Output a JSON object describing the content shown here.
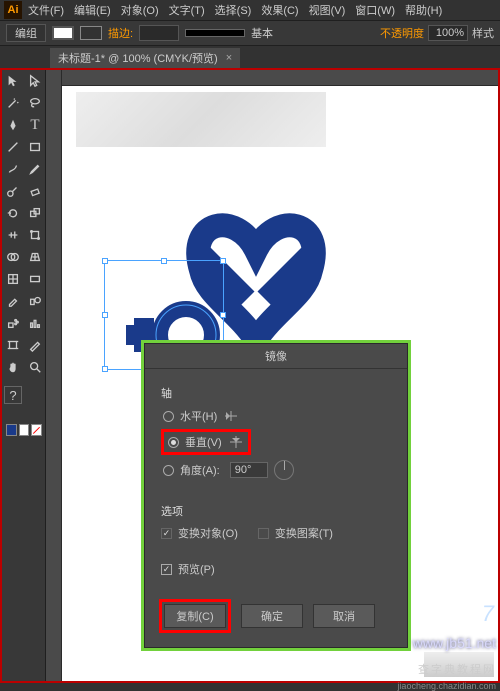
{
  "menu": {
    "file": "文件(F)",
    "edit": "编辑(E)",
    "object": "对象(O)",
    "type": "文字(T)",
    "select": "选择(S)",
    "effect": "效果(C)",
    "view": "视图(V)",
    "window": "窗口(W)",
    "help": "帮助(H)"
  },
  "optbar": {
    "group": "编组",
    "desc_label": "描边:",
    "basic": "基本",
    "opacity_label": "不透明度",
    "opacity_value": "100%",
    "style": "样式"
  },
  "doc_tab": "未标题-1* @ 100% (CMYK/预览)",
  "tools": {
    "selection": "selection",
    "direct": "direct-select",
    "wand": "magic-wand",
    "lasso": "lasso",
    "pen": "pen",
    "type": "type",
    "line": "line",
    "rect": "rectangle",
    "brush": "brush",
    "pencil": "pencil",
    "blob": "blob-brush",
    "eraser": "eraser",
    "rotate": "rotate",
    "scale": "scale",
    "width": "width",
    "warp": "free-transform",
    "shapebuilder": "shape-builder",
    "perspective": "perspective",
    "mesh": "mesh",
    "gradient": "gradient",
    "eyedrop": "eyedropper",
    "blend": "blend",
    "symbol": "symbol-spray",
    "graph": "column-graph",
    "artboard": "artboard",
    "slice": "slice",
    "hand": "hand",
    "zoom": "zoom",
    "help": "help"
  },
  "dialog": {
    "title": "镜像",
    "axis_section": "轴",
    "horiz": "水平(H)",
    "vert": "垂直(V)",
    "angle_label": "角度(A):",
    "angle_value": "90°",
    "options_section": "选项",
    "transform_objects": "变换对象(O)",
    "transform_patterns": "变换图案(T)",
    "preview": "预览(P)",
    "copy": "复制(C)",
    "ok": "确定",
    "cancel": "取消"
  },
  "watermarks": {
    "url": "www.jb51.net",
    "source": "jiaocheng.chazidian.com",
    "cn": "查字典教程网"
  },
  "page_number": "7",
  "colors": {
    "brand": "#1a3a8a",
    "highlight": "#f00",
    "dialog_border": "#72d13c"
  }
}
